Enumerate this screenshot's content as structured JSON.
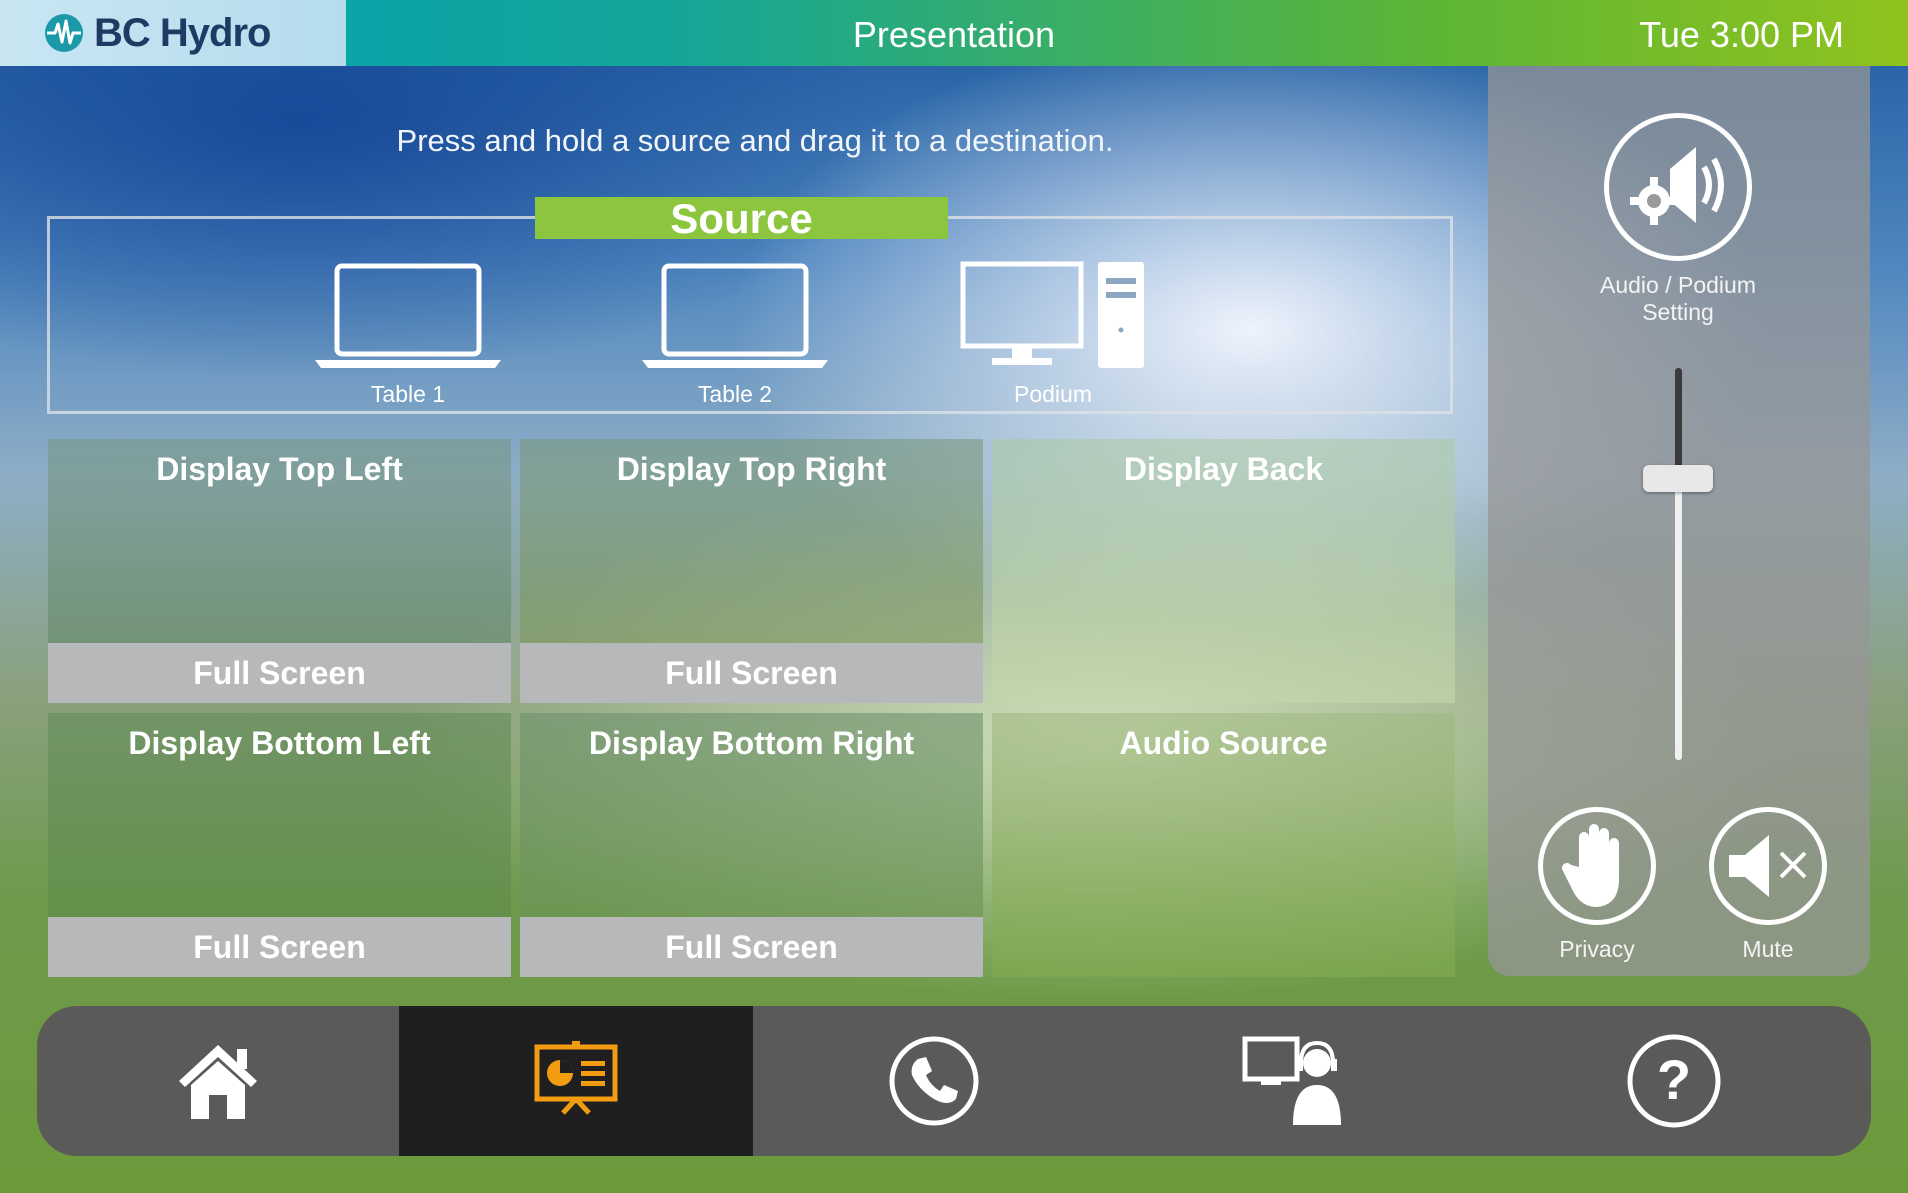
{
  "header": {
    "brand": "BC Hydro",
    "title": "Presentation",
    "time": "Tue 3:00 PM"
  },
  "instruction": "Press and hold a source and drag it to a destination.",
  "source": {
    "heading": "Source",
    "items": [
      {
        "label": "Table 1",
        "icon": "laptop-icon"
      },
      {
        "label": "Table 2",
        "icon": "laptop-icon"
      },
      {
        "label": "Podium",
        "icon": "desktop-computer-icon"
      }
    ]
  },
  "destinations": [
    {
      "title": "Display Top Left",
      "action": "Full Screen"
    },
    {
      "title": "Display Top Right",
      "action": "Full Screen"
    },
    {
      "title": "Display Back"
    },
    {
      "title": "Display Bottom Left",
      "action": "Full Screen"
    },
    {
      "title": "Display Bottom Right",
      "action": "Full Screen"
    },
    {
      "title": "Audio Source"
    }
  ],
  "side_panel": {
    "audio_setting_label_line1": "Audio / Podium",
    "audio_setting_label_line2": "Setting",
    "volume_level": 0.28,
    "privacy_label": "Privacy",
    "mute_label": "Mute"
  },
  "nav": {
    "items": [
      {
        "icon": "home-icon"
      },
      {
        "icon": "presentation-icon",
        "active": true
      },
      {
        "icon": "phone-icon"
      },
      {
        "icon": "support-agent-icon"
      },
      {
        "icon": "help-icon"
      }
    ],
    "active_color": "#f39c12"
  },
  "colors": {
    "accent_green": "#8cc63f",
    "header_teal": "#00a0b4"
  }
}
